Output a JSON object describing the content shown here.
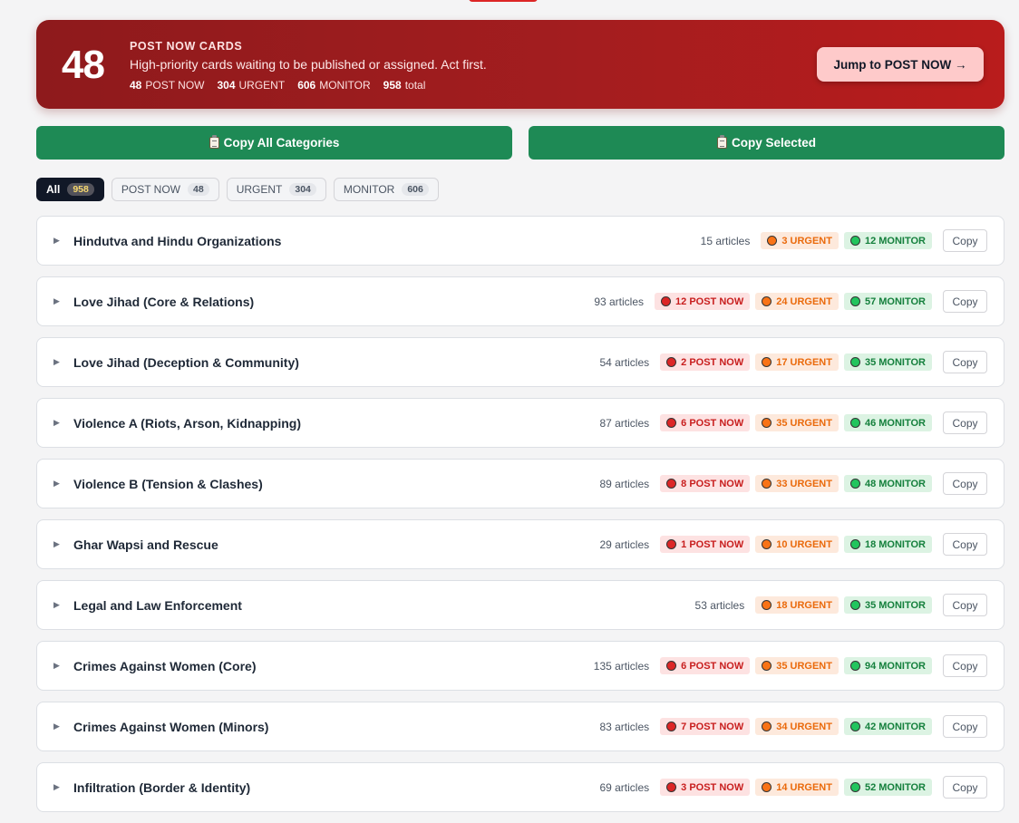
{
  "hero": {
    "count": "48",
    "title": "POST NOW CARDS",
    "description": "High-priority cards waiting to be published or assigned. Act first.",
    "stats": [
      {
        "value": "48",
        "label": "POST NOW"
      },
      {
        "value": "304",
        "label": "URGENT"
      },
      {
        "value": "606",
        "label": "MONITOR"
      },
      {
        "value": "958",
        "label": "total"
      }
    ],
    "jump_label": "Jump to POST NOW →",
    "color": "#a31d1f"
  },
  "actions": {
    "copy_all_label": "Copy All Categories",
    "copy_selected_label": "Copy Selected",
    "icon": "clipboard-icon",
    "color": "#1e8a55"
  },
  "filters": [
    {
      "label": "All",
      "count": "958",
      "active": true
    },
    {
      "label": "POST NOW",
      "count": "48",
      "active": false
    },
    {
      "label": "URGENT",
      "count": "304",
      "active": false
    },
    {
      "label": "MONITOR",
      "count": "606",
      "active": false
    }
  ],
  "categories": [
    {
      "name": "Hindutva and Hindu Organizations",
      "articles": "15 articles",
      "post_now": null,
      "urgent": "3 URGENT",
      "monitor": "12 MONITOR"
    },
    {
      "name": "Love Jihad (Core & Relations)",
      "articles": "93 articles",
      "post_now": "12 POST NOW",
      "urgent": "24 URGENT",
      "monitor": "57 MONITOR"
    },
    {
      "name": "Love Jihad (Deception & Community)",
      "articles": "54 articles",
      "post_now": "2 POST NOW",
      "urgent": "17 URGENT",
      "monitor": "35 MONITOR"
    },
    {
      "name": "Violence A (Riots, Arson, Kidnapping)",
      "articles": "87 articles",
      "post_now": "6 POST NOW",
      "urgent": "35 URGENT",
      "monitor": "46 MONITOR"
    },
    {
      "name": "Violence B (Tension & Clashes)",
      "articles": "89 articles",
      "post_now": "8 POST NOW",
      "urgent": "33 URGENT",
      "monitor": "48 MONITOR"
    },
    {
      "name": "Ghar Wapsi and Rescue",
      "articles": "29 articles",
      "post_now": "1 POST NOW",
      "urgent": "10 URGENT",
      "monitor": "18 MONITOR"
    },
    {
      "name": "Legal and Law Enforcement",
      "articles": "53 articles",
      "post_now": null,
      "urgent": "18 URGENT",
      "monitor": "35 MONITOR"
    },
    {
      "name": "Crimes Against Women (Core)",
      "articles": "135 articles",
      "post_now": "6 POST NOW",
      "urgent": "35 URGENT",
      "monitor": "94 MONITOR"
    },
    {
      "name": "Crimes Against Women (Minors)",
      "articles": "83 articles",
      "post_now": "7 POST NOW",
      "urgent": "34 URGENT",
      "monitor": "42 MONITOR"
    },
    {
      "name": "Infiltration (Border & Identity)",
      "articles": "69 articles",
      "post_now": "3 POST NOW",
      "urgent": "14 URGENT",
      "monitor": "52 MONITOR"
    }
  ],
  "copy_label": "Copy",
  "colors": {
    "post_now": "#dc2626",
    "urgent": "#f97316",
    "monitor": "#22c55e"
  }
}
